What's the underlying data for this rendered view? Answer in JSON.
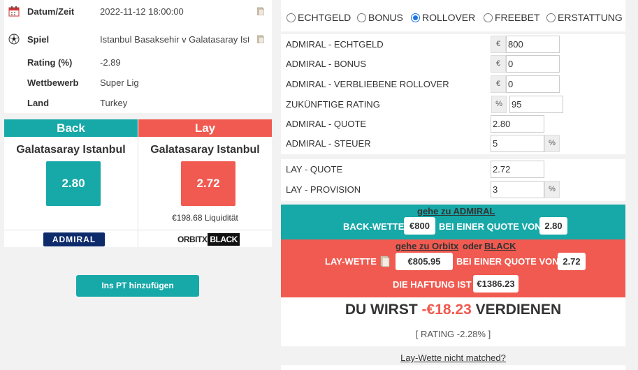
{
  "info": {
    "date_label": "Datum/Zeit",
    "date_value": "2022-11-12 18:00:00",
    "game_label": "Spiel",
    "game_value": "Istanbul Basaksehir v Galatasaray Istanbul",
    "rating_label": "Rating (%)",
    "rating_value": "-2.89",
    "competition_label": "Wettbewerb",
    "competition_value": "Super Lig",
    "country_label": "Land",
    "country_value": "Turkey"
  },
  "back": {
    "header": "Back",
    "team": "Galatasaray Istanbul",
    "odds": "2.80",
    "bookmaker_logo": "ADMIRAL"
  },
  "lay": {
    "header": "Lay",
    "team": "Galatasaray Istanbul",
    "odds": "2.72",
    "liquidity": "€198.68 Liquidität",
    "exchange_logo_a": "ORBITX",
    "exchange_logo_b": "BLACK"
  },
  "add_button": "Ins PT hinzufügen",
  "modes": [
    {
      "label": "ECHTGELD",
      "selected": false
    },
    {
      "label": "BONUS",
      "selected": false
    },
    {
      "label": "ROLLOVER",
      "selected": true
    },
    {
      "label": "FREEBET",
      "selected": false
    },
    {
      "label": "ERSTATTUNG",
      "selected": false
    }
  ],
  "form": {
    "realmoney_label": "ADMIRAL - ECHTGELD",
    "realmoney_addon": "€",
    "realmoney_value": "800",
    "bonus_label": "ADMIRAL - BONUS",
    "bonus_addon": "€",
    "bonus_value": "0",
    "rollover_label": "ADMIRAL - VERBLIEBENE ROLLOVER",
    "rollover_addon": "€",
    "rollover_value": "0",
    "future_label": "ZUKÜNFTIGE RATING",
    "future_addon": "%",
    "future_value": "95",
    "quote_label": "ADMIRAL - QUOTE",
    "quote_value": "2.80",
    "tax_label": "ADMIRAL - STEUER",
    "tax_value": "5",
    "tax_addon": "%",
    "lay_quote_label": "LAY - QUOTE",
    "lay_quote_value": "2.72",
    "lay_comm_label": "LAY - PROVISION",
    "lay_comm_value": "3",
    "lay_comm_addon": "%"
  },
  "result": {
    "goto_admiral": "gehe zu ADMIRAL",
    "back_bet_label": "BACK-WETTE",
    "back_stake": "€800",
    "at_odds_label": "BEI EINER QUOTE VON",
    "back_odds": "2.80",
    "goto_orbitx": "gehe zu  Orbitx",
    "or": "oder",
    "goto_black": "BLACK",
    "lay_bet_label": "LAY-WETTE",
    "lay_stake": "€805.95",
    "lay_at_odds_label": "BEI EINER QUOTE VON",
    "lay_odds": "2.72",
    "liability_label": "DIE HAFTUNG IST",
    "liability": "€1386.23"
  },
  "summary": {
    "prefix": "DU WIRST",
    "amount": "-€18.23",
    "suffix": "VERDIENEN",
    "rating": "[ RATING -2.28% ]"
  },
  "not_matched": "Lay-Wette nicht matched?"
}
